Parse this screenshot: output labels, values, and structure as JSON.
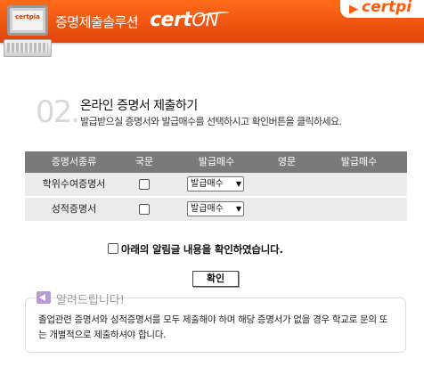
{
  "header": {
    "service_title": "증명제출솔루션",
    "brand_logo_text": "cert",
    "brand_logo_on": "ON",
    "laptop_screen_text": "certpia",
    "tab_logo_text": "certpi",
    "accent_color": "#ff5a0a"
  },
  "step": {
    "number": "02.",
    "title": "온라인 증명서 제출하기",
    "description": "발급받으실 증명서와 발급매수를 선택하시고 확인버튼을 클릭하세요."
  },
  "table": {
    "headers": [
      "증명서종류",
      "국문",
      "발급매수",
      "영문",
      "발급매수"
    ],
    "rows": [
      {
        "name": "학위수여증명서",
        "korean_checked": false,
        "count_select": "발급매수"
      },
      {
        "name": "성적증명서",
        "korean_checked": false,
        "count_select": "발급매수"
      }
    ]
  },
  "confirm": {
    "checkbox_label": "아래의 알림글 내용을 확인하였습니다.",
    "checked": false,
    "button_label": "확인"
  },
  "notice": {
    "title": "알려드립니다!",
    "body": "졸업관련 증명서와 성적증명서를 모두 제출해야 하며 해당 증명서가 없을 경우 학교로 문의 또는 개별적으로 제출하셔야 합니다.",
    "icon": "speaker-icon"
  }
}
